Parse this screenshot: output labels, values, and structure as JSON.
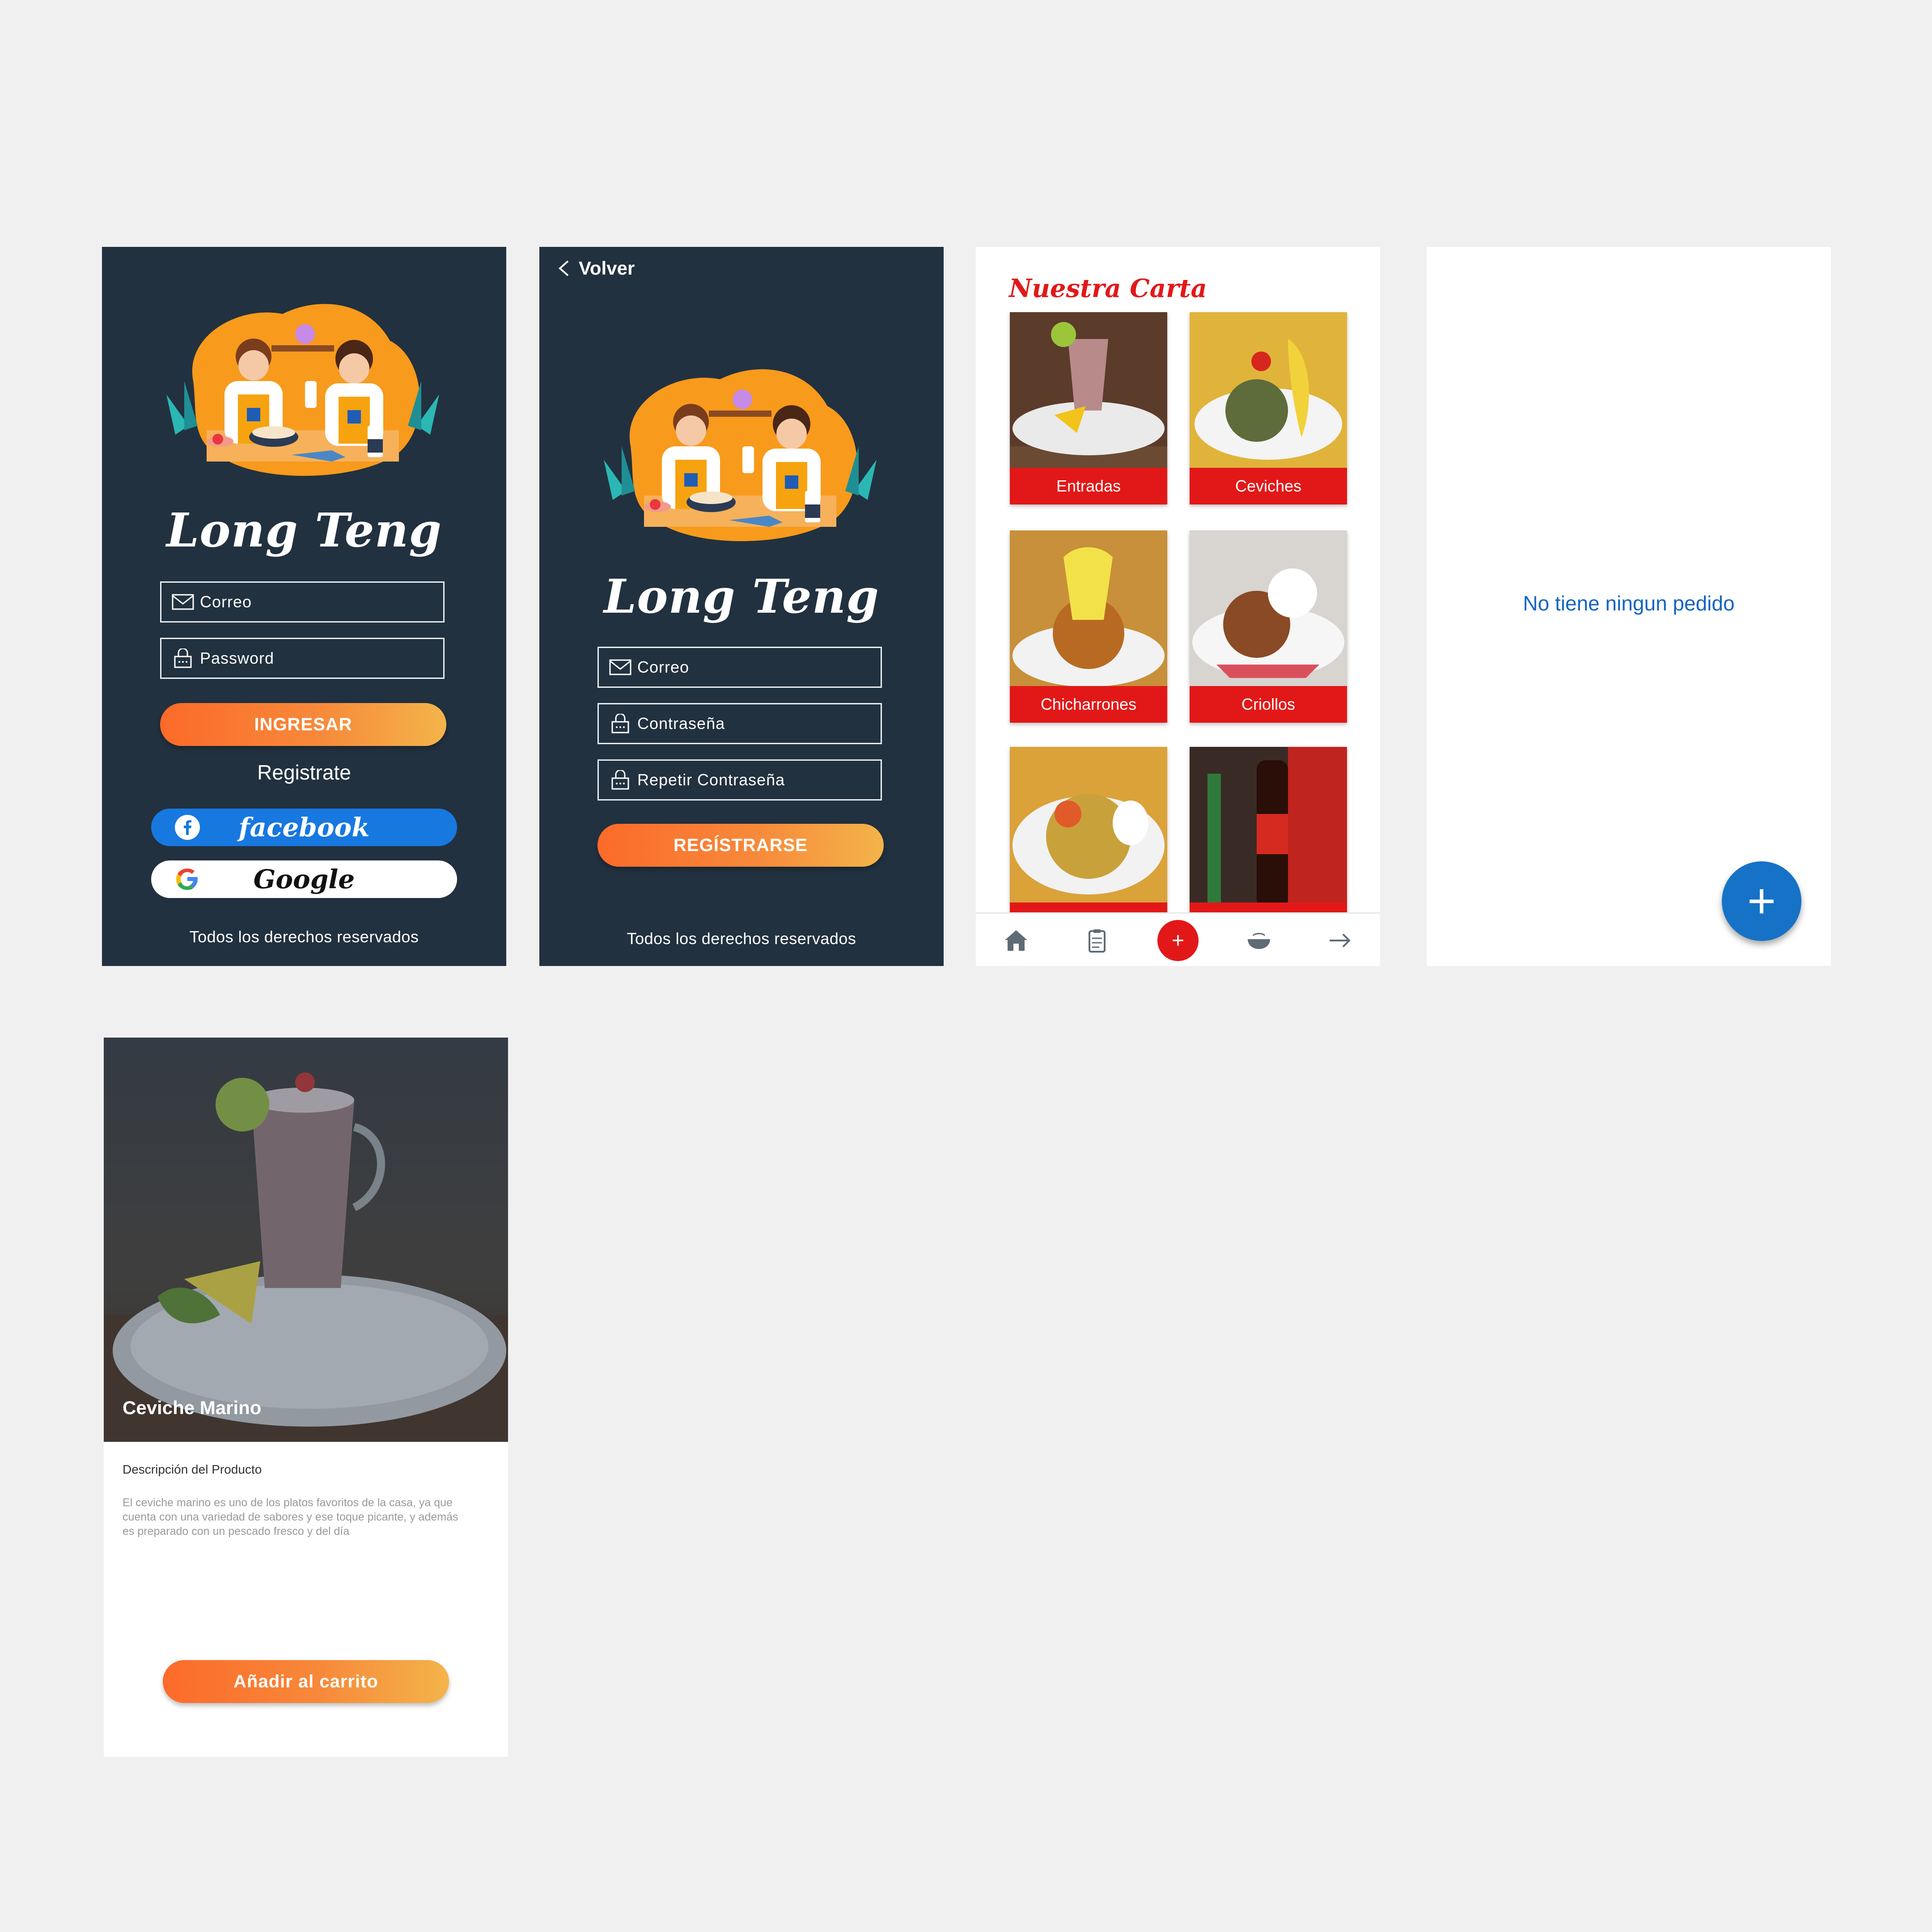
{
  "login": {
    "brand": "Long Teng",
    "email_placeholder": "Correo",
    "password_placeholder": "Password",
    "login_button": "INGRESAR",
    "register_link": "Registrate",
    "facebook_label": "facebook",
    "google_label": "Google",
    "footer": "Todos los derechos reservados"
  },
  "register": {
    "back_label": "Volver",
    "brand": "Long Teng",
    "email_placeholder": "Correo",
    "password_placeholder": "Contraseña",
    "repeat_password_placeholder": "Repetir Contraseña",
    "register_button": "REGÍSTRARSE",
    "footer": "Todos los derechos reservados"
  },
  "menu": {
    "title": "Nuestra Carta",
    "categories": [
      {
        "label": "Entradas"
      },
      {
        "label": "Ceviches"
      },
      {
        "label": "Chicharrones"
      },
      {
        "label": "Criollos"
      },
      {
        "label": ""
      },
      {
        "label": ""
      }
    ],
    "nav": [
      "home-icon",
      "clipboard-icon",
      "add-icon",
      "bowl-icon",
      "arrow-right-icon"
    ],
    "add_symbol": "+"
  },
  "orders": {
    "empty_message": "No tiene ningun pedido",
    "fab_symbol": "+"
  },
  "product": {
    "name": "Ceviche Marino",
    "description_heading": "Descripción del Producto",
    "description": "El ceviche marino es uno de los platos favoritos de la casa, ya que cuenta con una variedad de sabores y ese toque picante, y además es preparado con un pescado fresco y del día",
    "add_to_cart": "Añadir al carrito"
  },
  "colors": {
    "dark_bg": "#22313f",
    "accent_red": "#e21818",
    "orange_start": "#fc6a2a",
    "orange_end": "#f4b44a",
    "facebook_blue": "#1778e0",
    "fab_blue": "#1672c7",
    "canvas_bg": "#f0f0f0"
  }
}
